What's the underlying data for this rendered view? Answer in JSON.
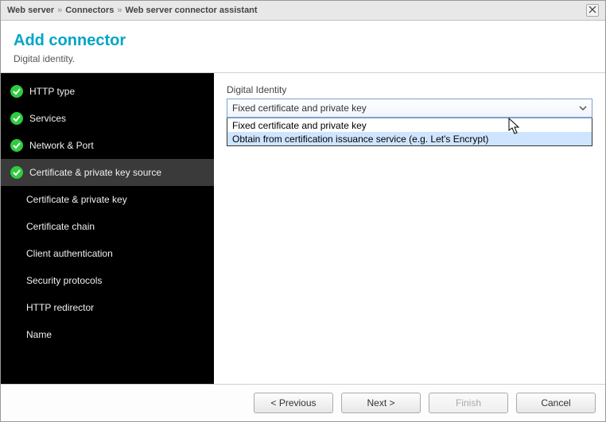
{
  "breadcrumb": {
    "item0": "Web server",
    "item1": "Connectors",
    "item2": "Web server connector assistant"
  },
  "header": {
    "title": "Add connector",
    "subtitle": "Digital identity."
  },
  "sidebar": {
    "items": [
      {
        "label": "HTTP type",
        "done": true,
        "sub": false,
        "selected": false
      },
      {
        "label": "Services",
        "done": true,
        "sub": false,
        "selected": false
      },
      {
        "label": "Network & Port",
        "done": true,
        "sub": false,
        "selected": false
      },
      {
        "label": "Certificate & private key source",
        "done": true,
        "sub": false,
        "selected": true
      },
      {
        "label": "Certificate & private key",
        "done": false,
        "sub": true,
        "selected": false
      },
      {
        "label": "Certificate chain",
        "done": false,
        "sub": true,
        "selected": false
      },
      {
        "label": "Client authentication",
        "done": false,
        "sub": true,
        "selected": false
      },
      {
        "label": "Security protocols",
        "done": false,
        "sub": true,
        "selected": false
      },
      {
        "label": "HTTP redirector",
        "done": false,
        "sub": true,
        "selected": false
      },
      {
        "label": "Name",
        "done": false,
        "sub": true,
        "selected": false
      }
    ]
  },
  "main": {
    "field_label": "Digital Identity",
    "select": {
      "value": "Fixed certificate and private key",
      "options": [
        {
          "label": "Fixed certificate and private key",
          "hover": false
        },
        {
          "label": "Obtain from certification issuance service (e.g. Let's Encrypt)",
          "hover": true
        }
      ]
    }
  },
  "footer": {
    "previous": "< Previous",
    "next": "Next >",
    "finish": "Finish",
    "cancel": "Cancel"
  }
}
